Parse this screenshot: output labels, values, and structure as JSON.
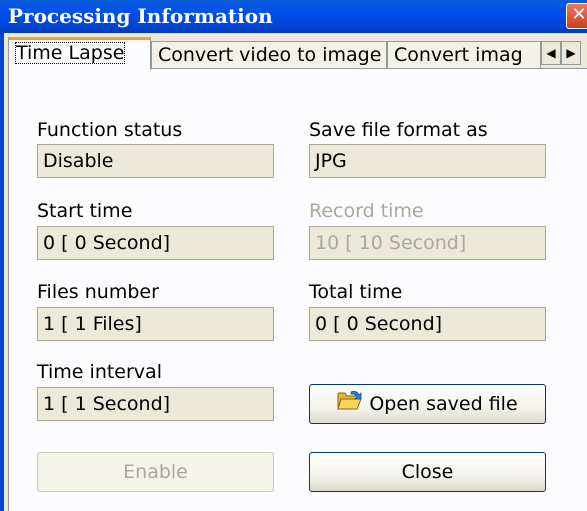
{
  "window": {
    "title": "Processing Information",
    "close_glyph": "✕"
  },
  "tabs": [
    {
      "label": "Time Lapse",
      "active": true
    },
    {
      "label": "Convert video to image",
      "active": false
    },
    {
      "label": "Convert imag",
      "active": false
    }
  ],
  "tab_scroll": {
    "left_icon": "arrow-left-icon",
    "right_icon": "arrow-right-icon",
    "left_glyph": "◀",
    "right_glyph": "▶"
  },
  "fields": {
    "function_status": {
      "label": "Function status",
      "value": "Disable"
    },
    "save_format": {
      "label": "Save file format as",
      "value": "JPG"
    },
    "start_time": {
      "label": "Start time",
      "value": "0 [ 0 Second]"
    },
    "record_time": {
      "label": "Record time",
      "value": "10 [ 10 Second]",
      "disabled": true
    },
    "files_number": {
      "label": "Files number",
      "value": "1 [ 1 Files]"
    },
    "total_time": {
      "label": "Total time",
      "value": "0 [ 0 Second]"
    },
    "time_interval": {
      "label": "Time interval",
      "value": "1 [ 1 Second]"
    }
  },
  "buttons": {
    "open_saved": {
      "label": "Open saved file",
      "icon": "folder-open-icon"
    },
    "enable": {
      "label": "Enable",
      "disabled": true
    },
    "close": {
      "label": "Close"
    }
  },
  "colors": {
    "titlebar": "#0047d9",
    "dialog_bg": "#ece9d8",
    "panel_bg": "#fcfcfe",
    "tab_highlight": "#e8a43a",
    "disabled_text": "#aca899"
  }
}
